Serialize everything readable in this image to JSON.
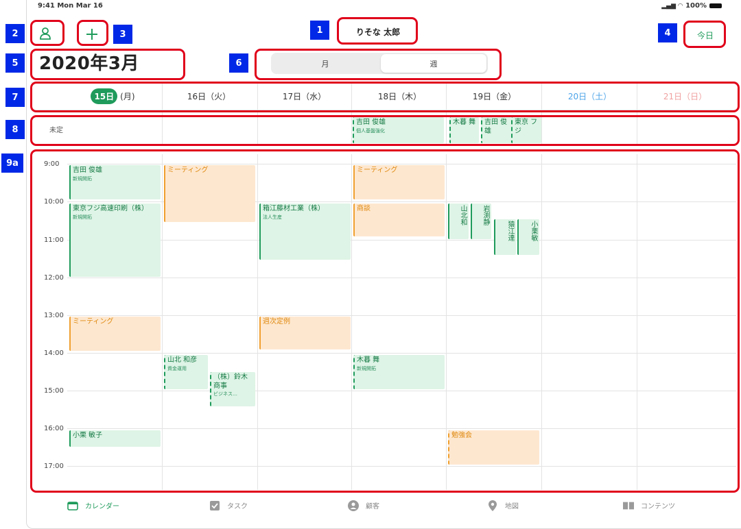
{
  "status": {
    "time_date": "9:41  Mon Mar 16",
    "battery": "100%"
  },
  "header": {
    "user_name": "りそな 太郎",
    "today_label": "今日",
    "month_title": "2020年3月"
  },
  "view_toggle": {
    "month": "月",
    "week": "週"
  },
  "annotations": [
    "1",
    "2",
    "3",
    "4",
    "5",
    "6",
    "7",
    "8",
    "9a"
  ],
  "days": [
    {
      "num": "15日",
      "wd": "(月)"
    },
    {
      "label": "16日（火）"
    },
    {
      "label": "17日（水）"
    },
    {
      "label": "18日（木）"
    },
    {
      "label": "19日（金）"
    },
    {
      "label": "20日（土）"
    },
    {
      "label": "21日（日）"
    }
  ],
  "undecided_label": "未定",
  "hours": [
    "9:00",
    "10:00",
    "11:00",
    "12:00",
    "13:00",
    "14:00",
    "15:00",
    "16:00",
    "17:00"
  ],
  "allday_events": [
    {
      "title": "吉田 俊雄",
      "sub": "個人基盤強化"
    },
    {
      "title": "木暮 舞"
    },
    {
      "title": "吉田 俊雄"
    },
    {
      "title": "東京 フジ"
    }
  ],
  "events": [
    {
      "title": "吉田 俊雄",
      "sub": "新規開拓"
    },
    {
      "title": "ミーティング"
    },
    {
      "title": "ミーティング"
    },
    {
      "title": "東京フジ高速印刷（株）",
      "sub": "新規開拓"
    },
    {
      "title": "箱江藤材工業（株）",
      "sub": "法人生産"
    },
    {
      "title": "商談"
    },
    {
      "title": "山北和"
    },
    {
      "title": "岩渕静"
    },
    {
      "title": "猿江達"
    },
    {
      "title": "小栗敏"
    },
    {
      "title": "ミーティング"
    },
    {
      "title": "週次定例"
    },
    {
      "title": "山北 和彦",
      "sub": "資金運用"
    },
    {
      "title": "（株）鈴木商事",
      "sub": "ビジネス…"
    },
    {
      "title": "木暮 舞",
      "sub": "新規開拓"
    },
    {
      "title": "小栗 敏子"
    },
    {
      "title": "勉強会"
    }
  ],
  "tabs": [
    {
      "label": "カレンダー"
    },
    {
      "label": "タスク"
    },
    {
      "label": "顧客"
    },
    {
      "label": "地図"
    },
    {
      "label": "コンテンツ"
    }
  ],
  "colors": {
    "accent": "#1f9b5b",
    "highlight_box": "#e0001a",
    "tag_blue": "#0028e6",
    "saturday": "#4ba3e8",
    "sunday": "#f0a0a0",
    "event_orange": "#fde7cf",
    "event_green": "#def4e6"
  }
}
